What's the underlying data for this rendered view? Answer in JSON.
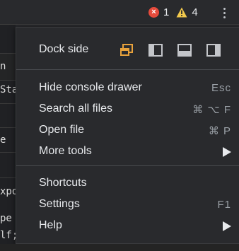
{
  "toolbar": {
    "error_count": "1",
    "warning_count": "4",
    "error_icon": "error-circle-icon",
    "warning_icon": "warning-triangle-icon",
    "more_icon": "kebab-menu-icon"
  },
  "left_fragments": [
    "n",
    "Sta",
    "e",
    "xpo",
    "pe",
    "lf;"
  ],
  "menu": {
    "dock_side_label": "Dock side",
    "dock_options": [
      "undock-into-separate-window-icon",
      "dock-to-left-icon",
      "dock-to-bottom-icon",
      "dock-to-right-icon"
    ],
    "items": [
      {
        "label": "Hide console drawer",
        "shortcut": "Esc"
      },
      {
        "label": "Search all files",
        "shortcut": "⌘ ⌥ F"
      },
      {
        "label": "Open file",
        "shortcut": "⌘ P"
      },
      {
        "label": "More tools",
        "submenu": true
      },
      {
        "label": "Shortcuts"
      },
      {
        "label": "Settings",
        "shortcut": "F1"
      },
      {
        "label": "Help",
        "submenu": true
      }
    ]
  },
  "colors": {
    "accent": "#e8a23c",
    "error": "#e64b3c",
    "warning": "#f2c94c",
    "menu_bg": "#292a2d",
    "text": "#e8eaed",
    "shortcut_text": "#9aa0a6"
  }
}
